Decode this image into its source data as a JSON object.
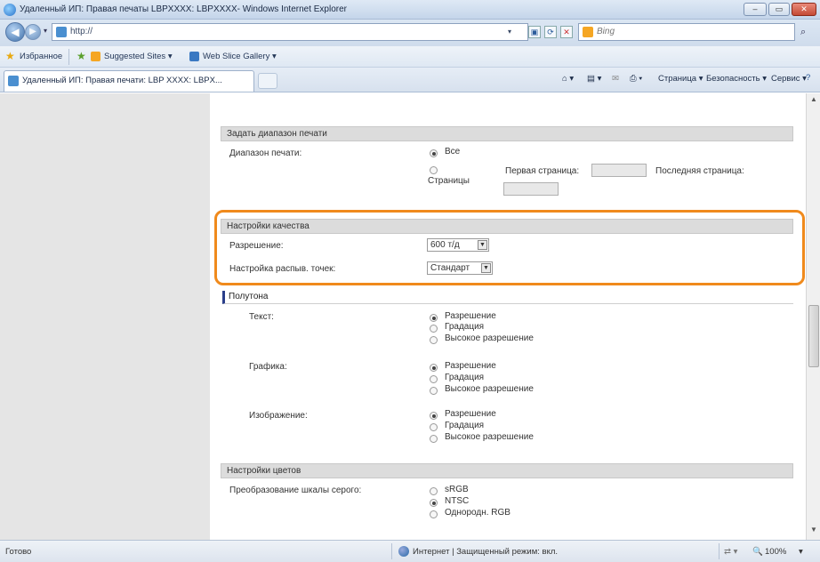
{
  "window": {
    "title": "Удаленный ИП: Правая печаты LBPXXXX: LBPXXXX- Windows Internet Explorer"
  },
  "address": {
    "url": "http://",
    "search_text": "Bing"
  },
  "favorites": {
    "label": "Избранное",
    "items": [
      "Suggested Sites ▾",
      "Web Slice Gallery ▾"
    ]
  },
  "tab": {
    "label": "Удаленный ИП: Правая печати: LBP XXXX: LBPX..."
  },
  "commandbar": {
    "items": [
      "Страница ▾",
      "Безопасность ▾",
      "Сервис ▾"
    ]
  },
  "page": {
    "range_section": {
      "header": "Задать диапазон печати",
      "label": "Диапазон печати:",
      "options": [
        {
          "label": "Все",
          "selected": true
        },
        {
          "label": "Страницы",
          "selected": false
        }
      ],
      "first_page_label": "Первая страница:",
      "last_page_label": "Последняя страница:"
    },
    "quality_section": {
      "header": "Настройки качества",
      "resolution_label": "Разрешение:",
      "resolution_value": "600 т/д",
      "dot_label": "Настройка распыв. точек:",
      "dot_value": "Стандарт"
    },
    "halftone_section": {
      "header": "Полутона",
      "groups": [
        {
          "label": "Текст:",
          "options": [
            "Разрешение",
            "Градация",
            "Высокое разрешение"
          ],
          "selected": 0
        },
        {
          "label": "Графика:",
          "options": [
            "Разрешение",
            "Градация",
            "Высокое разрешение"
          ],
          "selected": 0
        },
        {
          "label": "Изображение:",
          "options": [
            "Разрешение",
            "Градация",
            "Высокое разрешение"
          ],
          "selected": 0
        }
      ]
    },
    "color_section": {
      "header": "Настройки цветов",
      "label": "Преобразование шкалы серого:",
      "options": [
        "sRGB",
        "NTSC",
        "Однородн. RGB"
      ],
      "selected": 1
    }
  },
  "statusbar": {
    "left": "Готово",
    "zone": "Интернет | Защищенный режим: вкл.",
    "zoom": "100%"
  }
}
